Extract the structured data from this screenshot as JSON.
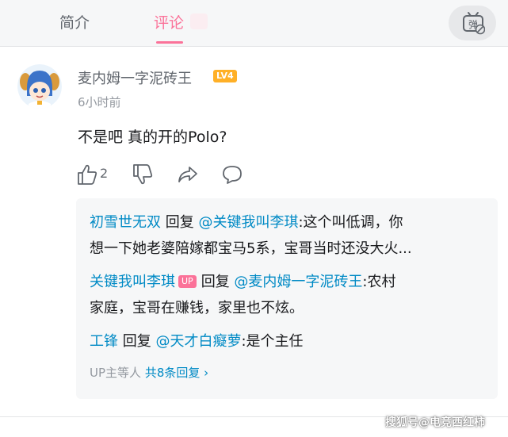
{
  "tabs": {
    "intro": "简介",
    "comments": "评论"
  },
  "comment": {
    "username": "麦内姆一字泥砖王",
    "level": "LV4",
    "time": "6小时前",
    "content": "不是吧 真的开的Polo?",
    "likes": "2"
  },
  "replies": [
    {
      "user": "初雪世无双",
      "verb": "回复",
      "mention": "@关键我叫李琪",
      "text": ":这个叫低调，你",
      "text2": "想一下她老婆陪嫁都宝马5系，宝哥当时还没大火..."
    },
    {
      "user": "关键我叫李琪",
      "badge": "UP",
      "verb": "回复",
      "mention": "@麦内姆一字泥砖王",
      "text": ":农村",
      "text2": "家庭，宝哥在赚钱，家里也不炫。"
    },
    {
      "user": "工锋",
      "verb": "回复",
      "mention": "@天才白癡萝",
      "text": ":是个主任"
    }
  ],
  "more": {
    "prefix": "UP主等人",
    "total": "共8条回复 ›"
  },
  "watermark": "搜狐号@电竞西红柿",
  "colors": {
    "accent": "#fb7299",
    "link": "#008ac5",
    "level_badge": "#ffb027"
  }
}
